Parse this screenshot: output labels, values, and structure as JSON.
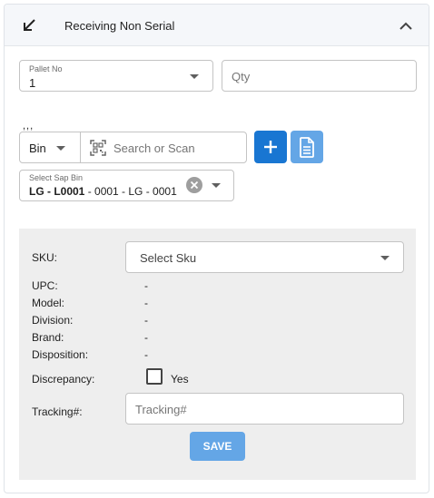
{
  "header": {
    "title": "Receiving Non Serial",
    "collapse_icon": "arrow-down-left-icon",
    "toggle_icon": "chevron-up-icon"
  },
  "pallet": {
    "label": "Pallet No",
    "value": "1"
  },
  "qty": {
    "placeholder": "Qty"
  },
  "ticks_text": ",,,",
  "bin": {
    "selected": "Bin"
  },
  "search": {
    "placeholder": "Search or Scan",
    "icon": "qr-scan-icon"
  },
  "actions": {
    "add_icon": "plus-icon",
    "doc_icon": "document-icon",
    "primary_color": "#1976d2",
    "secondary_color": "#64a6e6"
  },
  "sap_bin": {
    "label": "Select Sap Bin",
    "value_bold": "LG - L0001",
    "value_rest": " - 0001 - LG - 0001"
  },
  "form": {
    "sku_label": "SKU:",
    "sku_placeholder": "Select Sku",
    "fields": [
      {
        "label": "UPC:",
        "value": "-"
      },
      {
        "label": "Model:",
        "value": "-"
      },
      {
        "label": "Division:",
        "value": "-"
      },
      {
        "label": "Brand:",
        "value": "-"
      },
      {
        "label": "Disposition:",
        "value": "-"
      }
    ],
    "discrepancy_label": "Discrepancy:",
    "discrepancy_option": "Yes",
    "discrepancy_checked": false,
    "tracking_label": "Tracking#:",
    "tracking_placeholder": "Tracking#",
    "save_label": "SAVE"
  }
}
